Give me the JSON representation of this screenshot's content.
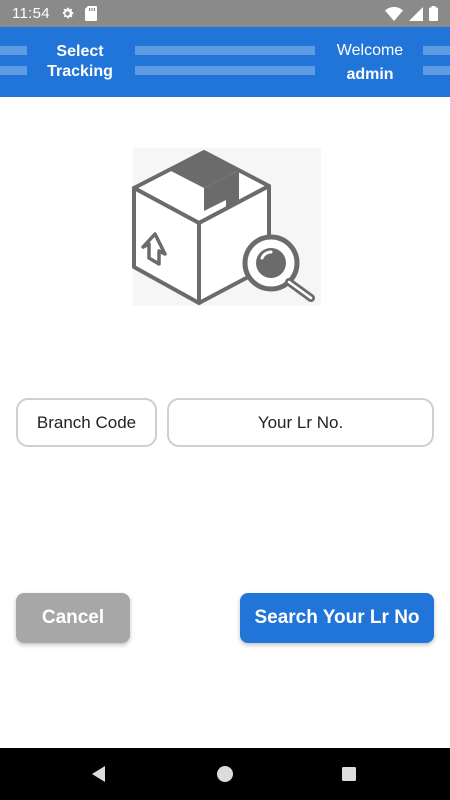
{
  "status_bar": {
    "time": "11:54",
    "icons": [
      "gear-icon",
      "sd-card-icon",
      "wifi-icon",
      "signal-icon",
      "battery-icon"
    ]
  },
  "header": {
    "title": "Select Tracking",
    "welcome": "Welcome",
    "user": "admin",
    "color": "#2175d8"
  },
  "illustration": {
    "icon": "package-search-icon"
  },
  "form": {
    "branch_placeholder": "Branch Code",
    "lr_placeholder": "Your Lr No."
  },
  "actions": {
    "cancel_label": "Cancel",
    "search_label": "Search Your Lr No",
    "cancel_color": "#a7a7a7",
    "search_color": "#2175d8"
  },
  "nav": {
    "icons": [
      "back-icon",
      "home-icon",
      "recents-icon"
    ]
  }
}
